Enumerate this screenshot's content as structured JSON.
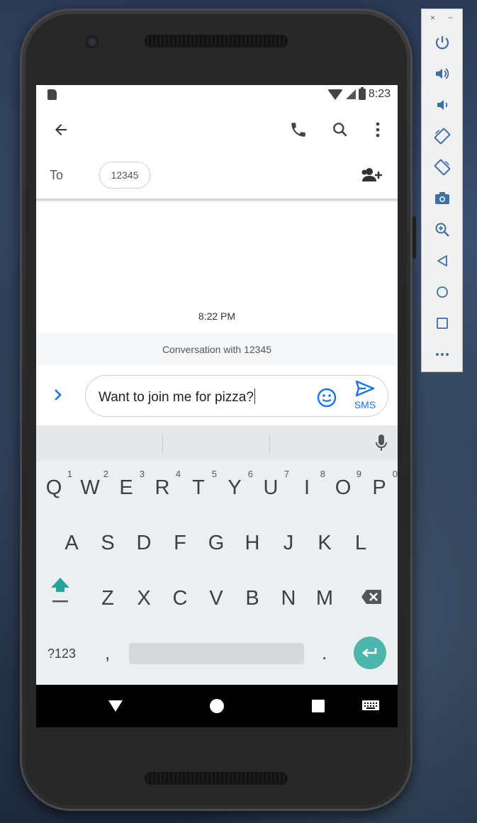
{
  "status_bar": {
    "time": "8:23"
  },
  "conversation": {
    "to_label": "To",
    "recipient": "12345",
    "timestamp": "8:22 PM",
    "banner": "Conversation with 12345"
  },
  "compose": {
    "text": "Want to join me for pizza?",
    "send_label": "SMS"
  },
  "keyboard": {
    "row1": [
      {
        "k": "Q",
        "n": "1"
      },
      {
        "k": "W",
        "n": "2"
      },
      {
        "k": "E",
        "n": "3"
      },
      {
        "k": "R",
        "n": "4"
      },
      {
        "k": "T",
        "n": "5"
      },
      {
        "k": "Y",
        "n": "6"
      },
      {
        "k": "U",
        "n": "7"
      },
      {
        "k": "I",
        "n": "8"
      },
      {
        "k": "O",
        "n": "9"
      },
      {
        "k": "P",
        "n": "0"
      }
    ],
    "row2": [
      "A",
      "S",
      "D",
      "F",
      "G",
      "H",
      "J",
      "K",
      "L"
    ],
    "row3": [
      "Z",
      "X",
      "C",
      "V",
      "B",
      "N",
      "M"
    ],
    "symbols_label": "?123",
    "comma": ",",
    "period": "."
  },
  "emulator_toolbar": {
    "close": "×",
    "minimize": "−",
    "buttons": [
      "power-icon",
      "volume-up-icon",
      "volume-down-icon",
      "rotate-left-icon",
      "rotate-right-icon",
      "camera-icon",
      "zoom-icon",
      "back-icon",
      "home-icon",
      "overview-icon",
      "more-icon"
    ]
  },
  "colors": {
    "accent": "#1a73e8",
    "enter_key": "#4db6ac",
    "shift_key": "#26a69a"
  }
}
